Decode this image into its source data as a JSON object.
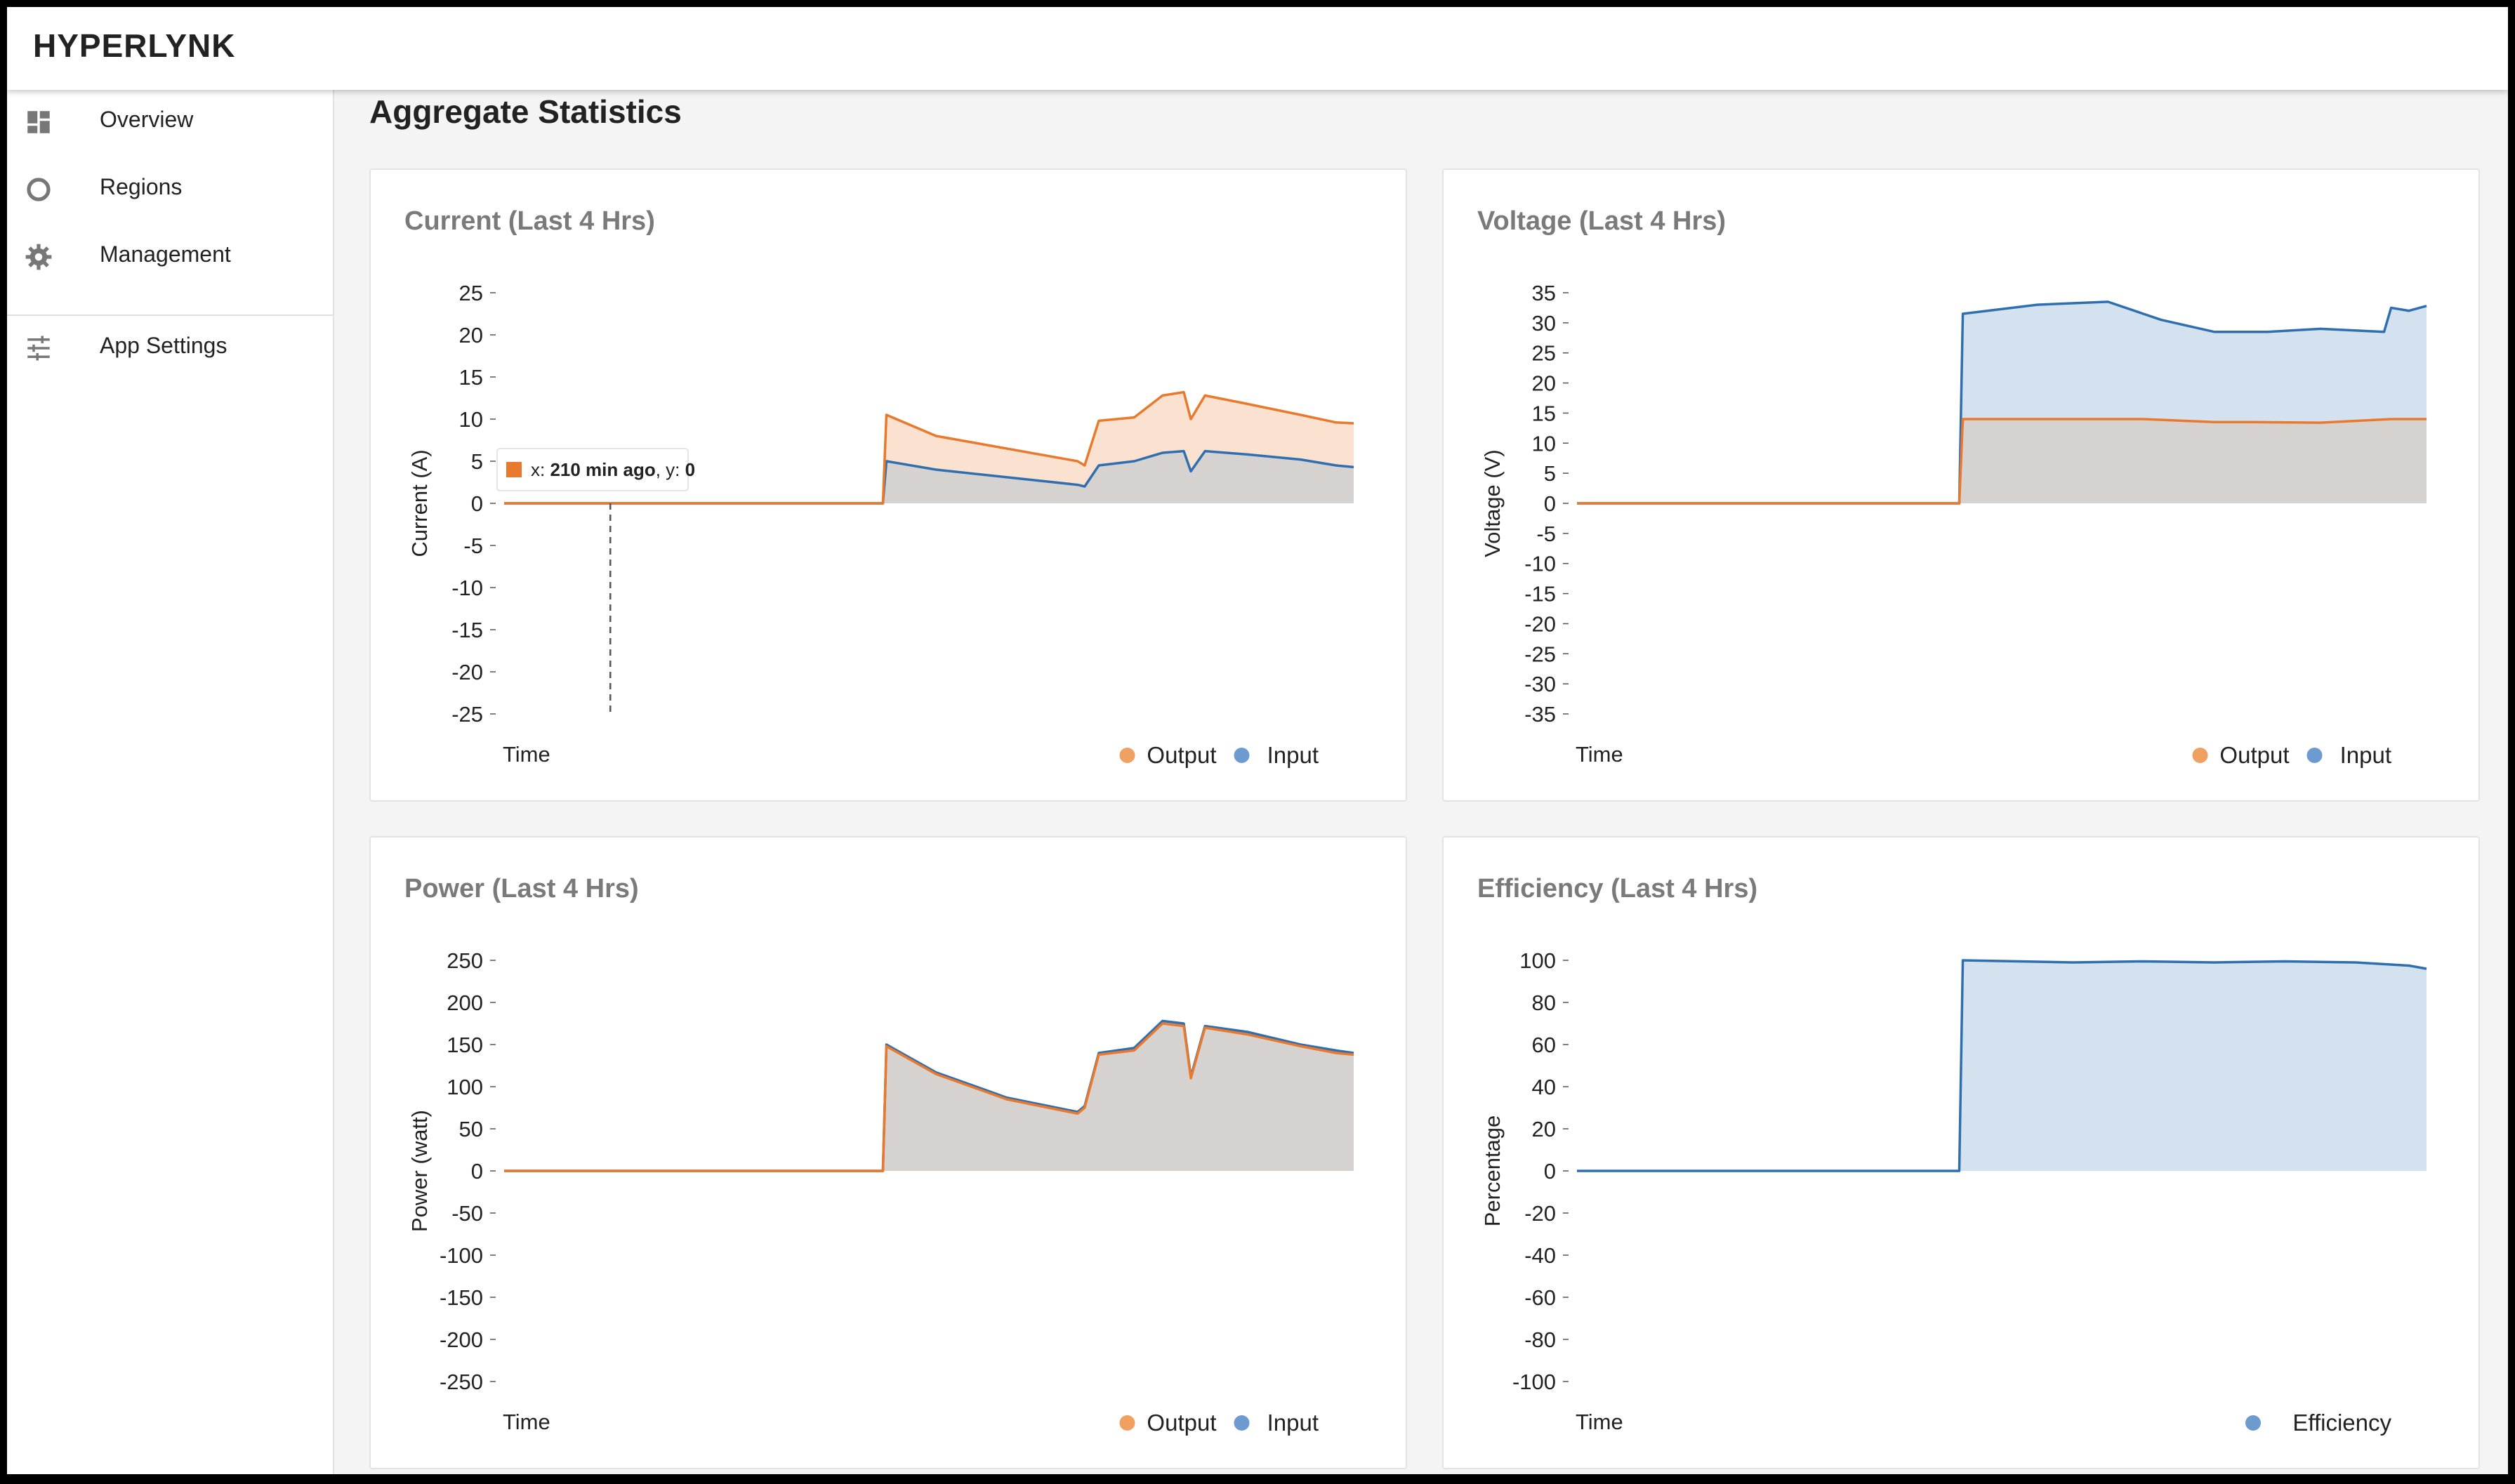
{
  "app": {
    "brand": "HYPERLYNK",
    "page_title": "Aggregate Statistics"
  },
  "sidebar": {
    "items": [
      {
        "label": "Overview",
        "icon": "dashboard-icon"
      },
      {
        "label": "Regions",
        "icon": "circle-icon"
      },
      {
        "label": "Management",
        "icon": "gear-icon"
      },
      {
        "label": "App Settings",
        "icon": "sliders-icon"
      }
    ]
  },
  "colors": {
    "output": "#f0a060",
    "output_line": "#e8792d",
    "output_fill": "#fbe2d0",
    "input": "#6d9bd0",
    "input_line": "#2f6fb0",
    "input_fill": "#d4e2f0",
    "overlap_fill": "#d6d2d0"
  },
  "tooltip": {
    "prefix": "x: ",
    "x_value": "210 min ago",
    "y_prefix": ", y: ",
    "y_value": "0"
  },
  "chart_data": [
    {
      "id": "current",
      "type": "area",
      "title": "Current (Last 4 Hrs)",
      "xlabel": "Time",
      "ylabel": "Current (A)",
      "ylim": [
        -25,
        25
      ],
      "yticks": [
        25,
        20,
        15,
        10,
        5,
        0,
        -5,
        -10,
        -15,
        -20,
        -25
      ],
      "x_range_min_ago": [
        240,
        0
      ],
      "legend": [
        "Output",
        "Input"
      ],
      "series": [
        {
          "name": "Output",
          "x_min_ago": [
            240,
            133,
            132,
            118,
            78,
            76,
            72,
            62,
            54,
            48,
            46,
            42,
            30,
            15,
            5,
            0
          ],
          "values": [
            0,
            0,
            10.5,
            8,
            5,
            4.5,
            9.8,
            10.2,
            12.8,
            13.2,
            10,
            12.8,
            11.8,
            10.5,
            9.6,
            9.5
          ]
        },
        {
          "name": "Input",
          "x_min_ago": [
            240,
            133,
            132,
            118,
            78,
            76,
            72,
            62,
            54,
            48,
            46,
            42,
            30,
            15,
            5,
            0
          ],
          "values": [
            0,
            0,
            5,
            4,
            2.2,
            2,
            4.5,
            5,
            6,
            6.2,
            3.8,
            6.2,
            5.8,
            5.2,
            4.5,
            4.3
          ]
        }
      ]
    },
    {
      "id": "voltage",
      "type": "area",
      "title": "Voltage (Last 4 Hrs)",
      "xlabel": "Time",
      "ylabel": "Voltage (V)",
      "ylim": [
        -35,
        35
      ],
      "yticks": [
        35,
        30,
        25,
        20,
        15,
        10,
        5,
        0,
        -5,
        -10,
        -15,
        -20,
        -25,
        -30,
        -35
      ],
      "x_range_min_ago": [
        240,
        0
      ],
      "legend": [
        "Output",
        "Input"
      ],
      "series": [
        {
          "name": "Output",
          "x_min_ago": [
            240,
            132,
            131,
            80,
            60,
            50,
            30,
            10,
            0
          ],
          "values": [
            0,
            0,
            14,
            14,
            13.5,
            13.5,
            13.4,
            14,
            14
          ]
        },
        {
          "name": "Input",
          "x_min_ago": [
            240,
            132,
            131,
            110,
            90,
            75,
            60,
            45,
            30,
            12,
            10,
            5,
            0
          ],
          "values": [
            0,
            0,
            31.5,
            33,
            33.5,
            30.5,
            28.5,
            28.5,
            29,
            28.5,
            32.5,
            32,
            32.8
          ]
        }
      ]
    },
    {
      "id": "power",
      "type": "area",
      "title": "Power (Last 4 Hrs)",
      "xlabel": "Time",
      "ylabel": "Power (watt)",
      "ylim": [
        -250,
        250
      ],
      "yticks": [
        250,
        200,
        150,
        100,
        50,
        0,
        -50,
        -100,
        -150,
        -200,
        -250
      ],
      "x_range_min_ago": [
        240,
        0
      ],
      "legend": [
        "Output",
        "Input"
      ],
      "series": [
        {
          "name": "Output",
          "x_min_ago": [
            240,
            133,
            132,
            118,
            98,
            78,
            76,
            72,
            62,
            54,
            48,
            46,
            42,
            30,
            15,
            5,
            0
          ],
          "values": [
            0,
            0,
            148,
            115,
            85,
            68,
            75,
            138,
            143,
            175,
            172,
            110,
            170,
            162,
            148,
            140,
            138
          ]
        },
        {
          "name": "Input",
          "x_min_ago": [
            240,
            133,
            132,
            118,
            98,
            78,
            76,
            72,
            62,
            54,
            48,
            46,
            42,
            30,
            15,
            5,
            0
          ],
          "values": [
            0,
            0,
            150,
            117,
            87,
            70,
            77,
            140,
            146,
            178,
            175,
            112,
            172,
            165,
            150,
            143,
            140
          ]
        }
      ]
    },
    {
      "id": "efficiency",
      "type": "area",
      "title": "Efficiency (Last 4 Hrs)",
      "xlabel": "Time",
      "ylabel": "Percentage",
      "ylim": [
        -100,
        100
      ],
      "yticks": [
        100,
        80,
        60,
        40,
        20,
        0,
        -20,
        -40,
        -60,
        -80,
        -100
      ],
      "x_range_min_ago": [
        240,
        0
      ],
      "legend": [
        "Efficiency"
      ],
      "series": [
        {
          "name": "Efficiency",
          "x_min_ago": [
            240,
            132,
            131,
            100,
            80,
            60,
            40,
            20,
            5,
            0
          ],
          "values": [
            0,
            0,
            100,
            99,
            99.5,
            99,
            99.5,
            99,
            97.5,
            96
          ]
        }
      ]
    }
  ]
}
